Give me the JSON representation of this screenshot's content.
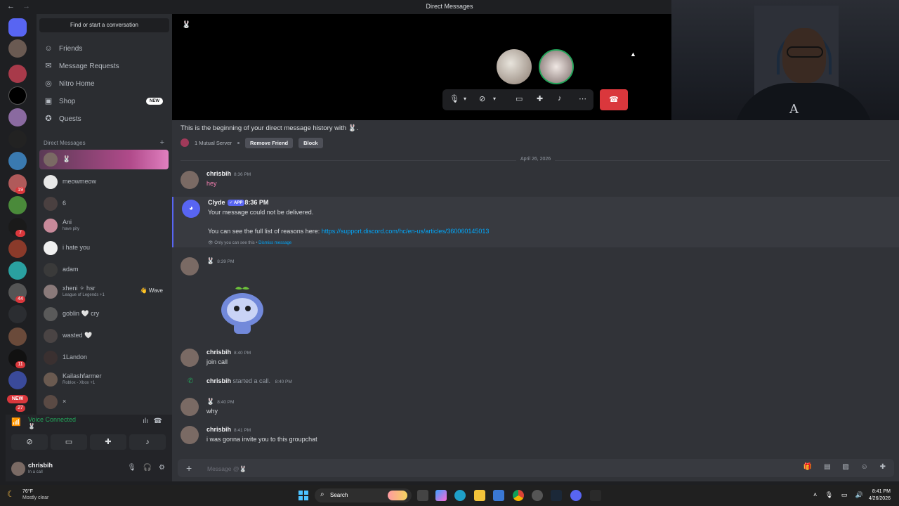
{
  "window": {
    "title": "Direct Messages",
    "back": "←",
    "forward": "→"
  },
  "rail": {
    "badges": [
      "19",
      "7",
      "44",
      "11",
      "27"
    ],
    "new_label": "NEW"
  },
  "sidebar": {
    "find_label": "Find or start a conversation",
    "nav": [
      {
        "label": "Friends",
        "icon": "friends-icon",
        "glyph": "☺"
      },
      {
        "label": "Message Requests",
        "icon": "mail-icon",
        "glyph": "✉"
      },
      {
        "label": "Nitro Home",
        "icon": "nitro-icon",
        "glyph": "◎"
      },
      {
        "label": "Shop",
        "icon": "shop-icon",
        "glyph": "▣",
        "pill": "NEW"
      },
      {
        "label": "Quests",
        "icon": "quests-icon",
        "glyph": "✪"
      }
    ],
    "dm_header": "Direct Messages",
    "dm_add": "+",
    "dms": [
      {
        "name": "🐰",
        "sub": ""
      },
      {
        "name": "meowmeow",
        "sub": ""
      },
      {
        "name": "6",
        "sub": ""
      },
      {
        "name": "Ani",
        "sub": "have pity"
      },
      {
        "name": "i hate you",
        "sub": ""
      },
      {
        "name": "adam",
        "sub": ""
      },
      {
        "name": "xheni ✧ hsr",
        "sub": "League of Legends +1",
        "wave": "👋 Wave"
      },
      {
        "name": "goblin 🤍 cry",
        "sub": ""
      },
      {
        "name": "wasted 🤍",
        "sub": ""
      },
      {
        "name": "1Landon",
        "sub": ""
      },
      {
        "name": "Kailashfarmer",
        "sub": "Roblox - Xbox +1"
      },
      {
        "name": "×",
        "sub": ""
      }
    ]
  },
  "voice": {
    "status": "Voice Connected",
    "channel": "🐰"
  },
  "user": {
    "name": "chrisbih",
    "status": "In a call"
  },
  "call": {
    "header": "🐰"
  },
  "chat": {
    "intro": "This is the beginning of your direct message history with 🐰.",
    "mutual": "1 Mutual Server",
    "remove_friend": "Remove Friend",
    "block": "Block",
    "date": "April 26, 2026",
    "messages": [
      {
        "author": "chrisbih",
        "time": "8:36 PM",
        "text": "hey"
      },
      {
        "author": "🐰",
        "time": "8:39 PM",
        "text": ""
      },
      {
        "author": "chrisbih",
        "time": "8:40 PM",
        "text": "join call"
      },
      {
        "author": "🐰",
        "time": "8:40 PM",
        "text": "why"
      },
      {
        "author": "chrisbih",
        "time": "8:41 PM",
        "text": "i was gonna invite you to this groupchat"
      }
    ],
    "clyde": {
      "author": "Clyde",
      "badge": "✓ APP",
      "time": "8:36 PM",
      "line1": "Your message could not be delivered.",
      "line2": "You can see the full list of reasons here: ",
      "link": "https://support.discord.com/hc/en-us/articles/360060145013",
      "only_you": "Only you can see this • ",
      "dismiss": "Dismiss message"
    },
    "system": {
      "author": "chrisbih",
      "action": "started a call.",
      "time": "8:40 PM"
    }
  },
  "composer": {
    "placeholder": "Message @🐰"
  },
  "taskbar": {
    "temp": "76°F",
    "weather": "Mostly clear",
    "search": "Search",
    "time": "8:41 PM",
    "date": "4/26/2026"
  },
  "colors": {
    "accent": "#5865f2",
    "online": "#23a55a",
    "danger": "#da373c",
    "link": "#00a8fc"
  }
}
